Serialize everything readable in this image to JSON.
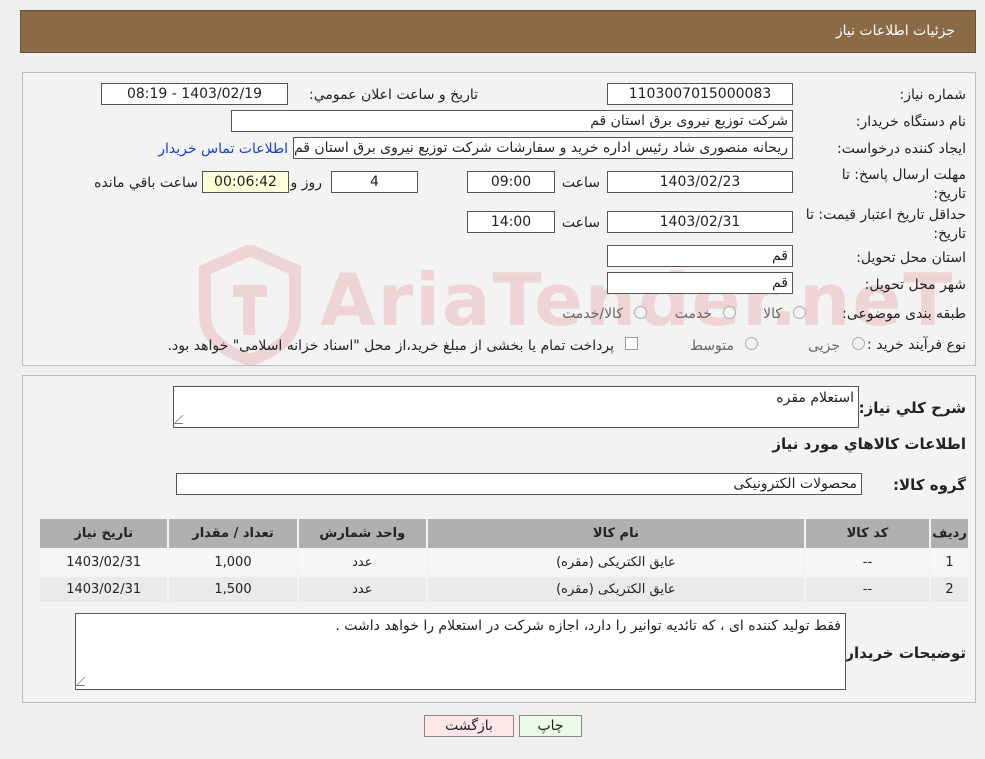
{
  "header": {
    "title": "جزئیات اطلاعات نیاز"
  },
  "form": {
    "need_number_label": "شماره نیاز:",
    "need_number": "1103007015000083",
    "announce_label": "تاریخ و ساعت اعلان عمومي:",
    "announce_value": "1403/02/19 - 08:19",
    "buyer_org_label": "نام دستگاه خریدار:",
    "buyer_org": "شرکت توزیع نیروی برق استان قم",
    "creator_label": "ایجاد کننده درخواست:",
    "creator": "ریحانه منصوری شاد رئیس اداره خرید و سفارشات شرکت توزیع نیروی برق استان قم",
    "contact_link": "اطلاعات تماس خریدار",
    "deadline_label_1": "مهلت ارسال پاسخ: تا",
    "deadline_label_2": "تاریخ:",
    "deadline_date": "1403/02/23",
    "time_word": "ساعت",
    "deadline_time": "09:00",
    "days_value": "4",
    "days_word": "روز و",
    "remaining_time": "00:06:42",
    "remaining_word": "ساعت باقي مانده",
    "validity_label_1": "حداقل تاریخ اعتبار قیمت: تا",
    "validity_label_2": "تاریخ:",
    "validity_date": "1403/02/31",
    "validity_time": "14:00",
    "province_label": "استان محل تحویل:",
    "province": "قم",
    "city_label": "شهر محل تحویل:",
    "city": "قم",
    "category_label": "طبقه بندی موضوعی:",
    "category_options": [
      "کالا",
      "خدمت",
      "کالا/خدمت"
    ],
    "process_label": "نوع فرآیند خرید :",
    "process_options": [
      "جزیی",
      "متوسط"
    ],
    "payment_note": "پرداخت تمام یا بخشی از مبلغ خرید،از محل \"اسناد خزانه اسلامی\" خواهد بود."
  },
  "details": {
    "summary_label": "شرح کلي نياز:",
    "summary_value": "استعلام مقره",
    "goods_info_title": "اطلاعات کالاهاي مورد نياز",
    "goods_group_label": "گروه کالا:",
    "goods_group_value": "محصولات الکترونیکی",
    "table": {
      "headers": [
        "رديف",
        "کد کالا",
        "نام کالا",
        "واحد شمارش",
        "تعداد / مقدار",
        "تاريخ نياز"
      ],
      "rows": [
        [
          "1",
          "--",
          "عایق الکتریکی (مقره)",
          "عدد",
          "1,000",
          "1403/02/31"
        ],
        [
          "2",
          "--",
          "عایق الکتریکی (مقره)",
          "عدد",
          "1,500",
          "1403/02/31"
        ]
      ]
    },
    "buyer_notes_label": "توضیحات خریدار:",
    "buyer_notes_value": "فقط تولید کننده ای ، که تائدیه توانیر را دارد، اجازه شرکت در استعلام را خواهد داشت ."
  },
  "buttons": {
    "print": "چاپ",
    "back": "بازگشت"
  },
  "watermark": {
    "brand_text": "AriaTender.neT"
  },
  "colors": {
    "header_bg": "#8b6a46",
    "link": "#1a3fc9",
    "print_btn_bg": "#eafbe6",
    "back_btn_bg": "#ffe6e6"
  }
}
